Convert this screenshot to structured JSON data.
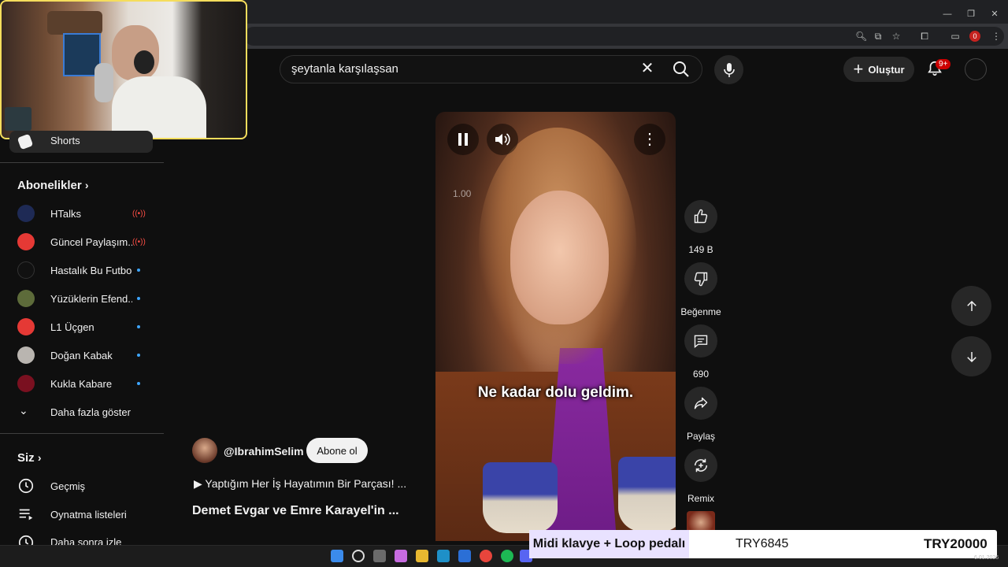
{
  "youtube": {
    "search": {
      "query": "şeytanla karşılaşsan"
    },
    "create_label": "Oluştur",
    "notification_count": "9+"
  },
  "sidebar": {
    "shorts_label": "Shorts",
    "subscriptions_heading": "Abonelikler",
    "subscriptions": [
      {
        "label": "HTalks",
        "status": "live"
      },
      {
        "label": "Güncel Paylaşım...",
        "status": "live"
      },
      {
        "label": "Hastalık Bu Futbol",
        "status": "new"
      },
      {
        "label": "Yüzüklerin Efend...",
        "status": "new"
      },
      {
        "label": "L1 Üçgen",
        "status": "new"
      },
      {
        "label": "Doğan Kabak",
        "status": "new"
      },
      {
        "label": "Kukla Kabare",
        "status": "new"
      }
    ],
    "show_more_label": "Daha fazla göster",
    "you_heading": "Siz",
    "you_items": [
      {
        "label": "Geçmiş",
        "icon": "history-icon"
      },
      {
        "label": "Oynatma listeleri",
        "icon": "playlist-icon"
      },
      {
        "label": "Daha sonra izle",
        "icon": "watch-later-icon"
      }
    ]
  },
  "video": {
    "speed": "1.00",
    "caption": "Ne kadar dolu geldim.",
    "channel": "@IbrahimSelim",
    "subscribe_label": "Abone ol",
    "song": "▶ Yaptığım Her İş Hayatımın Bir Parçası! ...",
    "title": "Demet Evgar ve Emre Karayel'in ..."
  },
  "actions": {
    "likes": "149 B",
    "dislike_label": "Beğenme",
    "comments": "690",
    "share_label": "Paylaş",
    "remix_label": "Remix"
  },
  "banner": {
    "label": "Midi klavye + Loop pedalı",
    "code": "TRY6845",
    "price": "TRY20000"
  },
  "chrome": {
    "profile_badge": "0"
  },
  "taskbar": {
    "date": "6.01.2026"
  }
}
